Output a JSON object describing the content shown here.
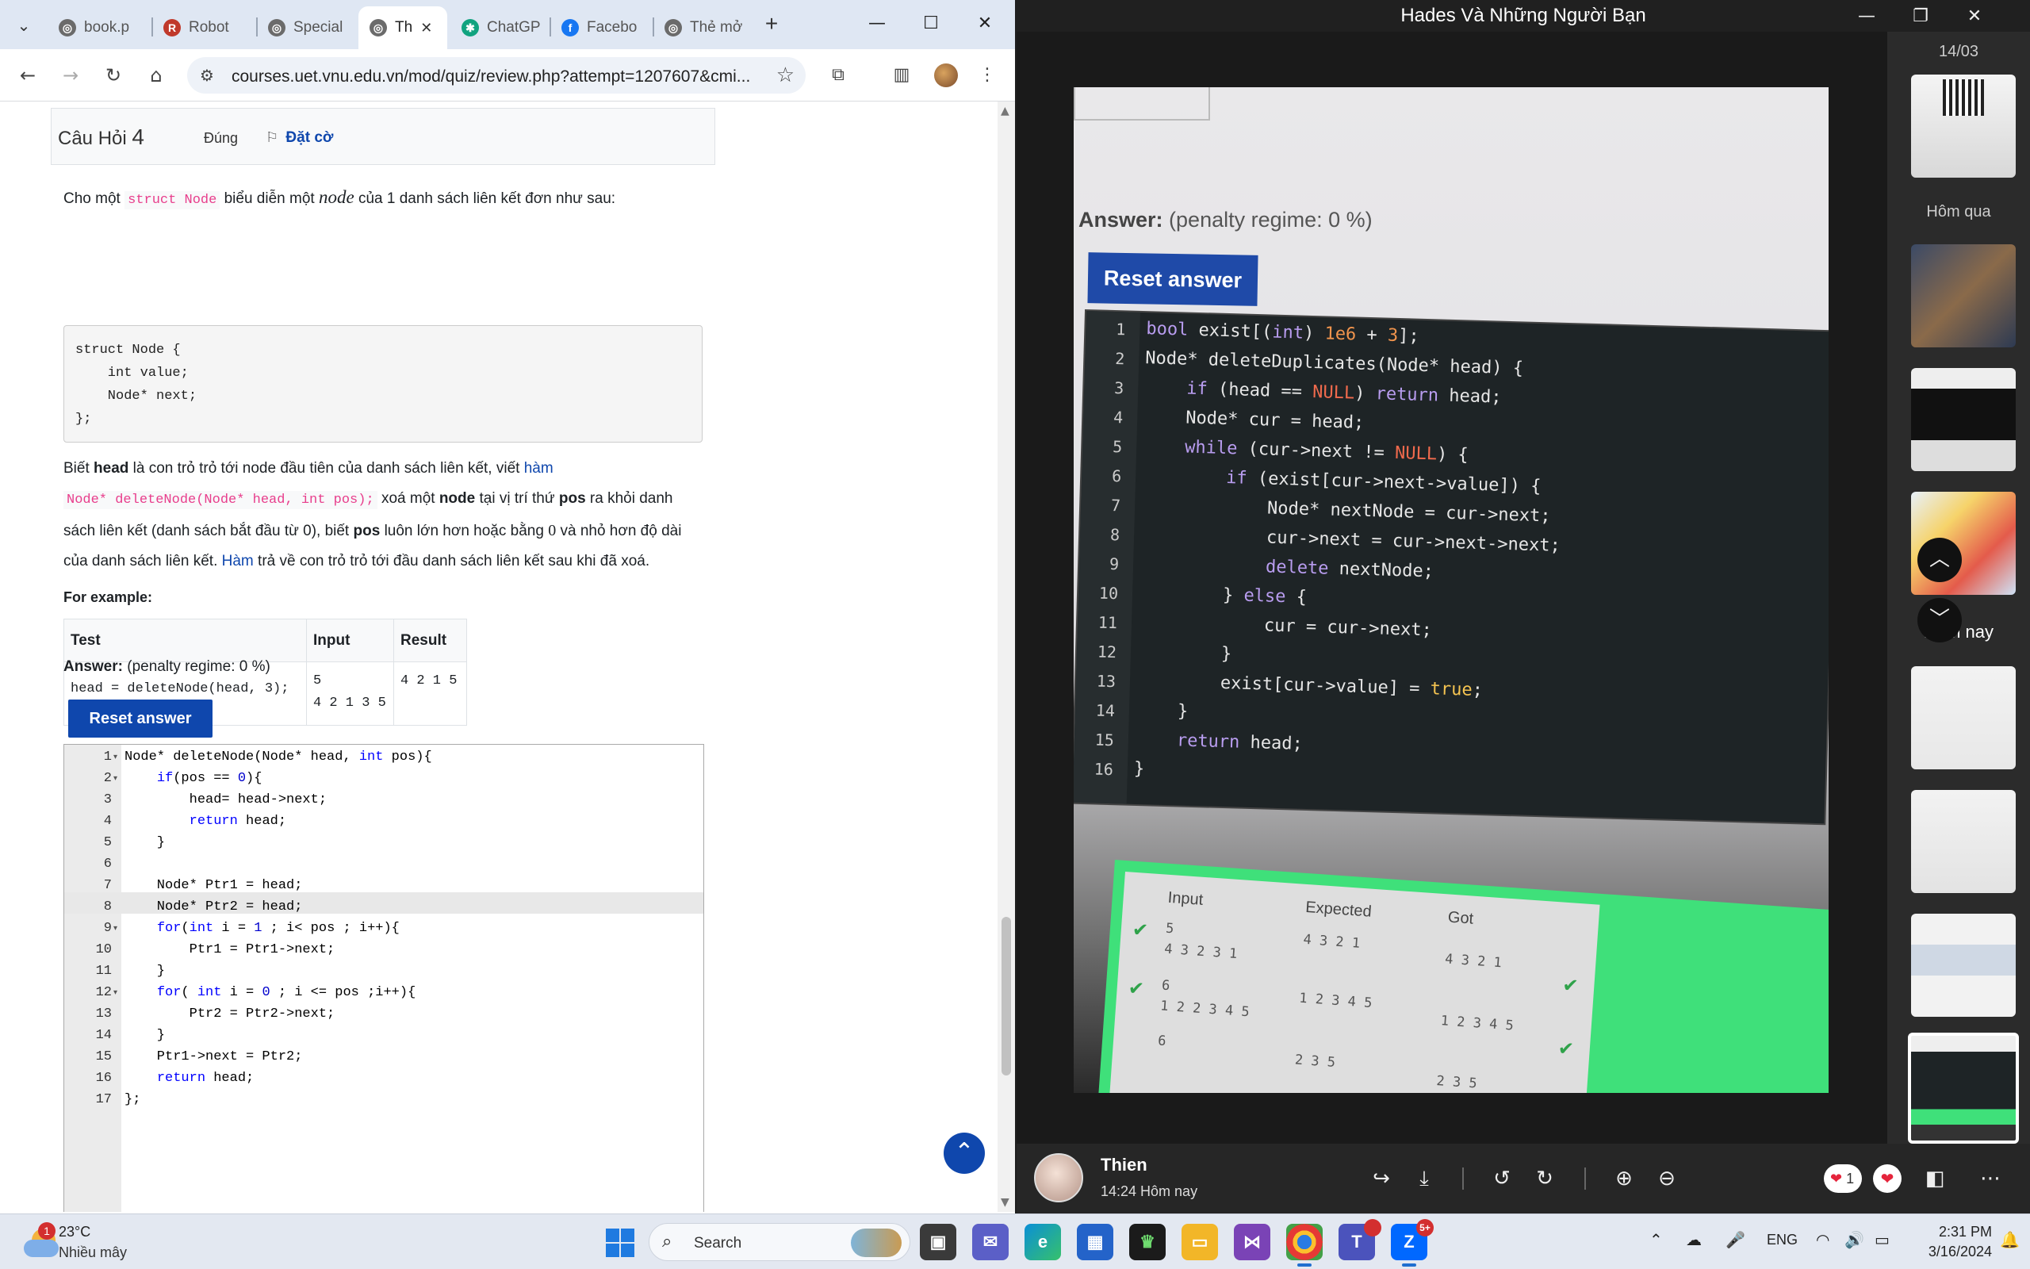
{
  "browser": {
    "tabs": [
      {
        "label": "book.p",
        "fav_color": "#6b6b6b",
        "fav_glyph": "◎"
      },
      {
        "label": "Robot",
        "fav_color": "#c0392b",
        "fav_glyph": "R"
      },
      {
        "label": "Special",
        "fav_color": "#6b6b6b",
        "fav_glyph": "◎"
      },
      {
        "label": "Th",
        "fav_color": "#6b6b6b",
        "fav_glyph": "◎"
      },
      {
        "label": "ChatGP",
        "fav_color": "#10a37f",
        "fav_glyph": "✱"
      },
      {
        "label": "Facebo",
        "fav_color": "#1877f2",
        "fav_glyph": "f"
      },
      {
        "label": "Thẻ mở",
        "fav_color": "#6b6b6b",
        "fav_glyph": "◎"
      }
    ],
    "url": "courses.uet.vnu.edu.vn/mod/quiz/review.php?attempt=1207607&cmi..."
  },
  "question": {
    "title_prefix": "Câu Hỏi",
    "number": "4",
    "state": "Đúng",
    "flag_label": "Đặt cờ",
    "intro_1": "Cho một",
    "intro_code": "struct Node",
    "intro_2": "biểu diễn một",
    "intro_math": "node",
    "intro_3": "của 1 danh sách liên kết đơn như sau:",
    "struct_code": "struct Node {\n    int value;\n    Node* next;\n};",
    "desc_1a": "Biết",
    "desc_head": "head",
    "desc_1b": "là con trỏ trỏ tới node đầu tiên của danh sách liên kết, viết",
    "desc_ham1": "hàm",
    "desc_sig": "Node* deleteNode(Node* head, int pos);",
    "desc_2a": "xoá một",
    "desc_node": "node",
    "desc_2b": "tại vị trí thứ",
    "desc_pos1": "pos",
    "desc_2c": "ra khỏi danh",
    "desc_3a": "sách liên kết (danh sách bắt đầu từ 0), biết",
    "desc_pos2": "pos",
    "desc_3b": "luôn lớn hơn hoặc bằng",
    "desc_zero": "0",
    "desc_3c": "và nhỏ hơn độ dài",
    "desc_4a": "của danh sách liên kết.",
    "desc_ham2": "Hàm",
    "desc_4b": "trả về con trỏ trỏ tới đầu danh sách liên kết sau khi đã xoá.",
    "example_label": "For example:",
    "table": {
      "headers": [
        "Test",
        "Input",
        "Result"
      ],
      "row": {
        "test": "head = deleteNode(head, 3);",
        "input_1": "5",
        "input_2": "4 2 1 3 5",
        "result": "4 2 1 5"
      }
    },
    "answer_label": "Answer:",
    "penalty": "(penalty regime: 0 %)",
    "reset_label": "Reset answer",
    "code_lines": [
      "Node* deleteNode(Node* head, int pos){",
      "    if(pos == 0){",
      "        head= head->next;",
      "        return head;",
      "    }",
      "",
      "    Node* Ptr1 = head;",
      "    Node* Ptr2 = head;",
      "    for(int i = 1 ; i< pos ; i++){",
      "        Ptr1 = Ptr1->next;",
      "    }",
      "    for( int i = 0 ; i <= pos ;i++){",
      "        Ptr2 = Ptr2->next;",
      "    }",
      "    Ptr1->next = Ptr2;",
      "    return head;",
      "};"
    ]
  },
  "viewer": {
    "window_title": "Hades Và Những Người Bạn",
    "photo": {
      "answer_label": "Answer:",
      "penalty": "(penalty regime: 0 %)",
      "reset_label": "Reset answer",
      "code_lines": [
        "bool exist[(int) 1e6 + 3];",
        "Node* deleteDuplicates(Node* head) {",
        "    if (head == NULL) return head;",
        "    Node* cur = head;",
        "    while (cur->next != NULL) {",
        "        if (exist[cur->next->value]) {",
        "            Node* nextNode = cur->next;",
        "            cur->next = cur->next->next;",
        "            delete nextNode;",
        "        } else {",
        "            cur = cur->next;",
        "        }",
        "        exist[cur->value] = true;",
        "    }",
        "    return head;",
        "}"
      ],
      "results_headers": [
        "Input",
        "Expected",
        "Got"
      ],
      "results_rows": [
        {
          "input_1": "5",
          "input_2": "4 3 2 3 1",
          "expected": "4 3 2 1",
          "got": "4 3 2 1"
        },
        {
          "input_1": "6",
          "input_2": "1 2 2 3 4 5",
          "expected": "1 2 3 4 5",
          "got": "1 2 3 4 5"
        },
        {
          "input_1": "6",
          "input_2": "",
          "expected": "2 3 5",
          "got": "2 3 5"
        }
      ]
    },
    "sidebar": {
      "date_1": "14/03",
      "date_2": "Hôm qua",
      "date_3": "Hôm nay"
    },
    "sender": {
      "name": "Thien",
      "time": "14:24 Hôm nay"
    },
    "reaction_count": "1"
  },
  "taskbar": {
    "weather_temp": "23°C",
    "weather_desc": "Nhiều mây",
    "weather_badge": "1",
    "search_placeholder": "Search",
    "lang": "ENG",
    "time": "2:31 PM",
    "date": "3/16/2024",
    "zalo_badge": "5+"
  }
}
